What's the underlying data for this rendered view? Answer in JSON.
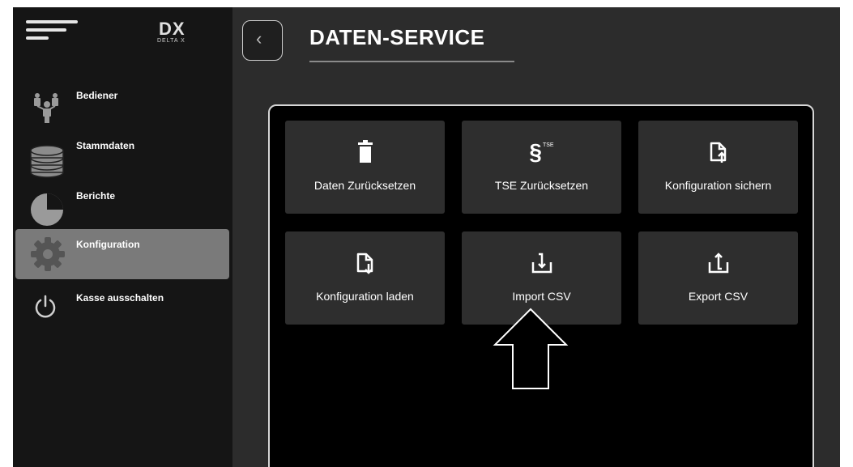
{
  "sidebar": {
    "logo_text": "DX",
    "logo_brand": "DELTA X",
    "items": [
      {
        "label": "Bediener",
        "icon": "users-icon"
      },
      {
        "label": "Stammdaten",
        "icon": "database-icon"
      },
      {
        "label": "Berichte",
        "icon": "pie-chart-icon"
      },
      {
        "label": "Konfiguration",
        "icon": "gear-icon",
        "active": true
      },
      {
        "label": "Kasse ausschalten",
        "icon": "power-icon"
      }
    ]
  },
  "header": {
    "title": "DATEN-SERVICE",
    "back_icon": "chevron-left-icon"
  },
  "tiles": [
    {
      "label": "Daten Zurücksetzen",
      "icon": "trash-icon"
    },
    {
      "label": "TSE Zurücksetzen",
      "icon": "section-tse-icon",
      "icon_text": "§",
      "icon_sup": "TSE"
    },
    {
      "label": "Konfiguration sichern",
      "icon": "file-upload-icon"
    },
    {
      "label": "Konfiguration laden",
      "icon": "file-download-icon"
    },
    {
      "label": "Import CSV",
      "icon": "import-icon"
    },
    {
      "label": "Export CSV",
      "icon": "export-icon"
    }
  ],
  "annotation": {
    "icon": "up-arrow-outline-icon",
    "points_to": "Import CSV"
  },
  "colors": {
    "sidebar_bg": "#151515",
    "main_bg": "#2c2c2c",
    "panel_bg": "#000000",
    "tile_bg": "#2e2e2e",
    "active_item_bg": "#7a7a7a",
    "text": "#ffffff"
  }
}
